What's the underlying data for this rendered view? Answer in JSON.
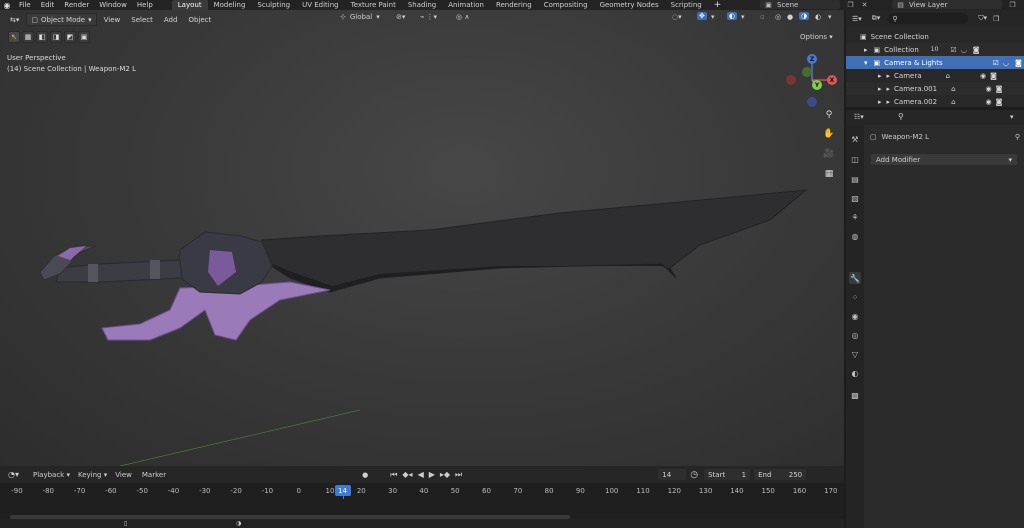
{
  "topbar": {
    "menus": [
      "File",
      "Edit",
      "Render",
      "Window",
      "Help"
    ],
    "workspaces": [
      "Layout",
      "Modeling",
      "Sculpting",
      "UV Editing",
      "Texture Paint",
      "Shading",
      "Animation",
      "Rendering",
      "Compositing",
      "Geometry Nodes",
      "Scripting"
    ],
    "active_workspace": "Layout",
    "scene": "Scene",
    "view_layer": "View Layer"
  },
  "viewport": {
    "mode": "Object Mode",
    "menus": [
      "View",
      "Select",
      "Add",
      "Object"
    ],
    "transform_orientation": "Global",
    "options_label": "Options",
    "info_line1": "User Perspective",
    "info_line2": "(14) Scene Collection | Weapon-M2 L",
    "gizmo": {
      "z": "Z",
      "y": "Y",
      "x": "X"
    }
  },
  "timeline": {
    "menus": [
      "Playback",
      "Keying",
      "View",
      "Marker"
    ],
    "current_frame": "14",
    "start_label": "Start",
    "start_value": "1",
    "end_label": "End",
    "end_value": "250",
    "ticks": [
      "-90",
      "-80",
      "-70",
      "-60",
      "-50",
      "-40",
      "-30",
      "-20",
      "-10",
      "0",
      "10",
      "20",
      "30",
      "40",
      "50",
      "60",
      "70",
      "80",
      "90",
      "100",
      "110",
      "120",
      "130",
      "140",
      "150",
      "160",
      "170"
    ]
  },
  "outliner": {
    "root": "Scene Collection",
    "items": [
      {
        "label": "Collection",
        "badge": "10"
      },
      {
        "label": "Camera & Lights",
        "selected": true
      },
      {
        "label": "Camera"
      },
      {
        "label": "Camera.001"
      },
      {
        "label": "Camera.002"
      }
    ]
  },
  "properties": {
    "object_name": "Weapon-M2 L",
    "add_modifier_label": "Add Modifier"
  },
  "colors": {
    "accent": "#3e6fb8",
    "playhead": "#3d7bd6",
    "blade": "#2f2f33",
    "purple": "#9a7ab8"
  }
}
